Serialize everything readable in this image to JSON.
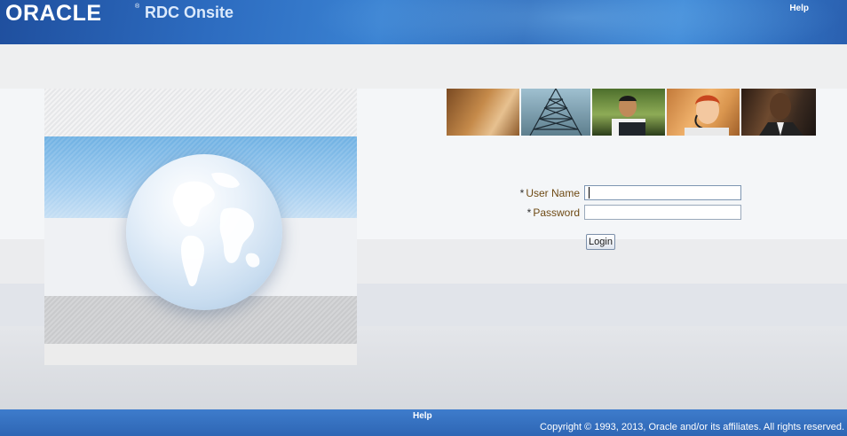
{
  "header": {
    "brand": "ORACLE",
    "registered_mark": "®",
    "app_title": "RDC Onsite",
    "help_label": "Help"
  },
  "login_form": {
    "username_label": "User Name",
    "password_label": "Password",
    "required_marker": "*",
    "username_value": "",
    "password_value": "",
    "login_button": "Login"
  },
  "footer": {
    "help_label": "Help",
    "copyright": "Copyright © 1993, 2013, Oracle and/or its affiliates. All rights reserved."
  },
  "colors": {
    "header_blue": "#2d6cc0",
    "footer_blue": "#3571c2",
    "label_brown": "#6e4a14"
  },
  "icons": {
    "globe": "globe-illustration",
    "photos": [
      "photo-team-meeting",
      "photo-power-tower",
      "photo-man-at-computer",
      "photo-headset-agent",
      "photo-businessman"
    ]
  }
}
